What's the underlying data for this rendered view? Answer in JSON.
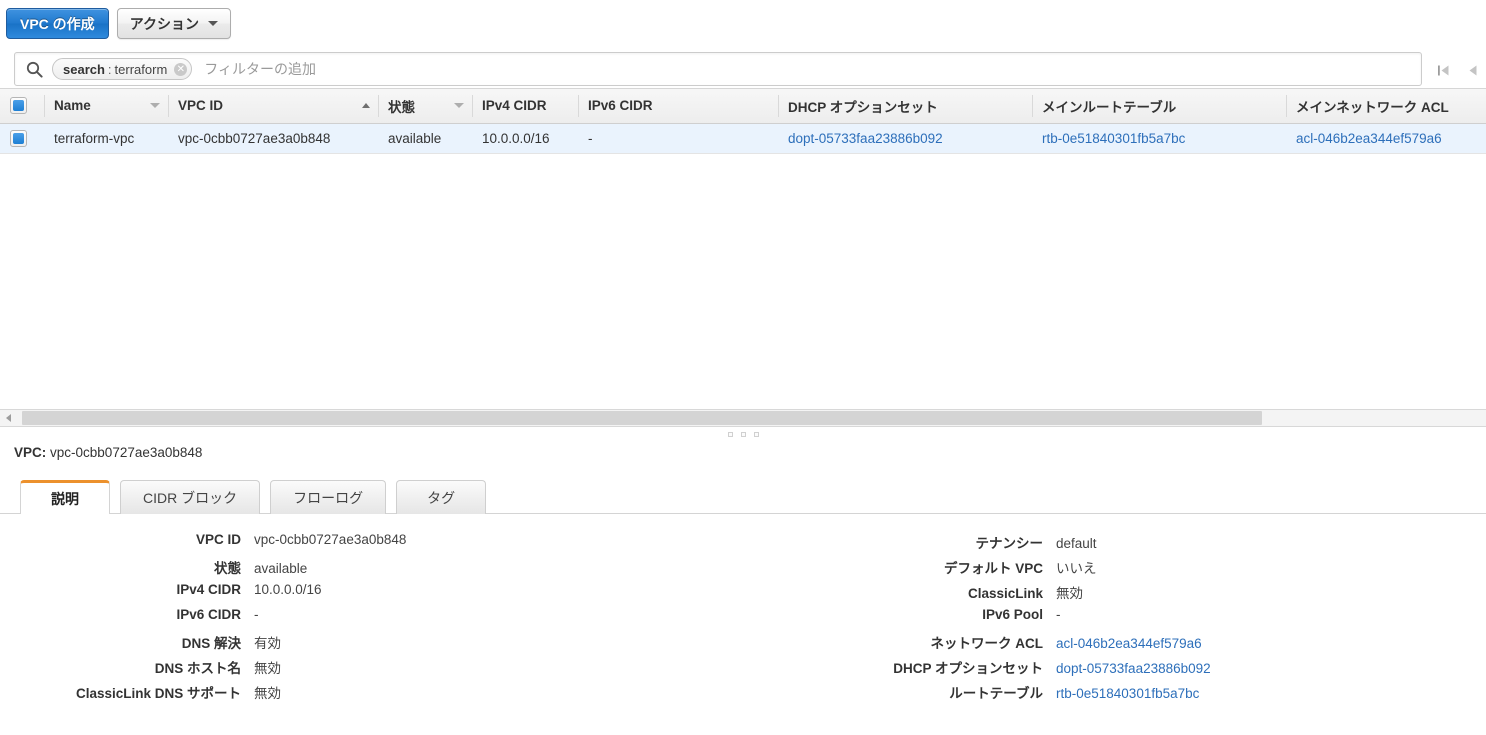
{
  "toolbar": {
    "create_button": "VPC の作成",
    "actions_button": "アクション",
    "caret_icon": "caret-down-icon"
  },
  "search": {
    "icon": "search-icon",
    "token": {
      "key": "search",
      "separator": ":",
      "value": "terraform",
      "clear_icon": "clear-token-icon"
    },
    "placeholder": "フィルターの追加"
  },
  "pagination": {
    "first_icon": "page-first-icon",
    "prev_icon": "page-prev-icon"
  },
  "table": {
    "select_all_checkbox": "select-all-checkbox",
    "columns": [
      {
        "label": "Name",
        "sort": "menu"
      },
      {
        "label": "VPC ID",
        "sort": "asc"
      },
      {
        "label": "状態",
        "sort": "menu"
      },
      {
        "label": "IPv4 CIDR",
        "sort": "none"
      },
      {
        "label": "IPv6 CIDR",
        "sort": "none"
      },
      {
        "label": "DHCP オプションセット",
        "sort": "none"
      },
      {
        "label": "メインルートテーブル",
        "sort": "none"
      },
      {
        "label": "メインネットワーク ACL",
        "sort": "none"
      }
    ],
    "rows": [
      {
        "selected": true,
        "name": "terraform-vpc",
        "vpc_id": "vpc-0cbb0727ae3a0b848",
        "state": "available",
        "ipv4_cidr": "10.0.0.0/16",
        "ipv6_cidr": "-",
        "dhcp_option_set": "dopt-05733faa23886b092",
        "main_route_table": "rtb-0e51840301fb5a7bc",
        "main_network_acl": "acl-046b2ea344ef579a6"
      }
    ]
  },
  "scrollbar": {
    "left_arrow_icon": "scroll-left-arrow-icon",
    "thumb": "horizontal-scroll-thumb"
  },
  "splitter": {
    "grip_icon": "splitter-grip-icon"
  },
  "detail": {
    "title_label": "VPC:",
    "title_value": "vpc-0cbb0727ae3a0b848",
    "tabs": [
      {
        "label": "説明",
        "active": true
      },
      {
        "label": "CIDR ブロック",
        "active": false
      },
      {
        "label": "フローログ",
        "active": false
      },
      {
        "label": "タグ",
        "active": false
      }
    ],
    "left_fields": [
      {
        "label": "VPC ID",
        "value": "vpc-0cbb0727ae3a0b848",
        "style": "text"
      },
      {
        "label": "状態",
        "value": "available",
        "style": "state"
      },
      {
        "label": "IPv4 CIDR",
        "value": "10.0.0.0/16",
        "style": "text"
      },
      {
        "label": "IPv6 CIDR",
        "value": "-",
        "style": "text"
      },
      {
        "label": "DNS 解決",
        "value": "有効",
        "style": "text"
      },
      {
        "label": "DNS ホスト名",
        "value": "無効",
        "style": "text"
      },
      {
        "label": "ClassicLink DNS サポート",
        "value": "無効",
        "style": "text"
      }
    ],
    "right_fields": [
      {
        "label": "テナンシー",
        "value": "default",
        "style": "text"
      },
      {
        "label": "デフォルト VPC",
        "value": "いいえ",
        "style": "text"
      },
      {
        "label": "ClassicLink",
        "value": "無効",
        "style": "text"
      },
      {
        "label": "IPv6 Pool",
        "value": "-",
        "style": "text"
      },
      {
        "label": "ネットワーク ACL",
        "value": "acl-046b2ea344ef579a6",
        "style": "link"
      },
      {
        "label": "DHCP オプションセット",
        "value": "dopt-05733faa23886b092",
        "style": "link"
      },
      {
        "label": "ルートテーブル",
        "value": "rtb-0e51840301fb5a7bc",
        "style": "link"
      }
    ]
  },
  "colors": {
    "primary_button": "#2079ce",
    "link": "#2d6fba",
    "state_ok": "#3d9c3d",
    "active_tab_accent": "#ec912d",
    "row_selected_bg": "#eaf3fd"
  }
}
